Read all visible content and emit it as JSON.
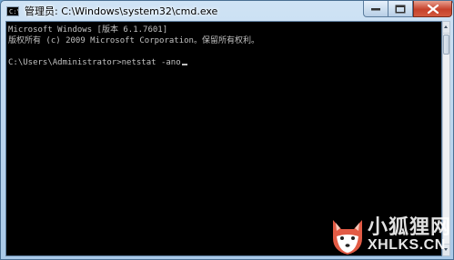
{
  "window": {
    "title": "管理员: C:\\Windows\\system32\\cmd.exe",
    "app_icon_text": "C:\\",
    "controls": {
      "minimize": "minimize-icon",
      "maximize": "maximize-icon",
      "close": "close-icon"
    }
  },
  "console": {
    "lines": [
      "Microsoft Windows [版本 6.1.7601]",
      "版权所有 (c) 2009 Microsoft Corporation。保留所有权利。",
      "",
      "C:\\Users\\Administrator>netstat -ano"
    ],
    "text_color": "#c0c0c0",
    "background": "#000000"
  },
  "watermark": {
    "name": "小狐狸网",
    "url": "XHLKS.CN"
  }
}
